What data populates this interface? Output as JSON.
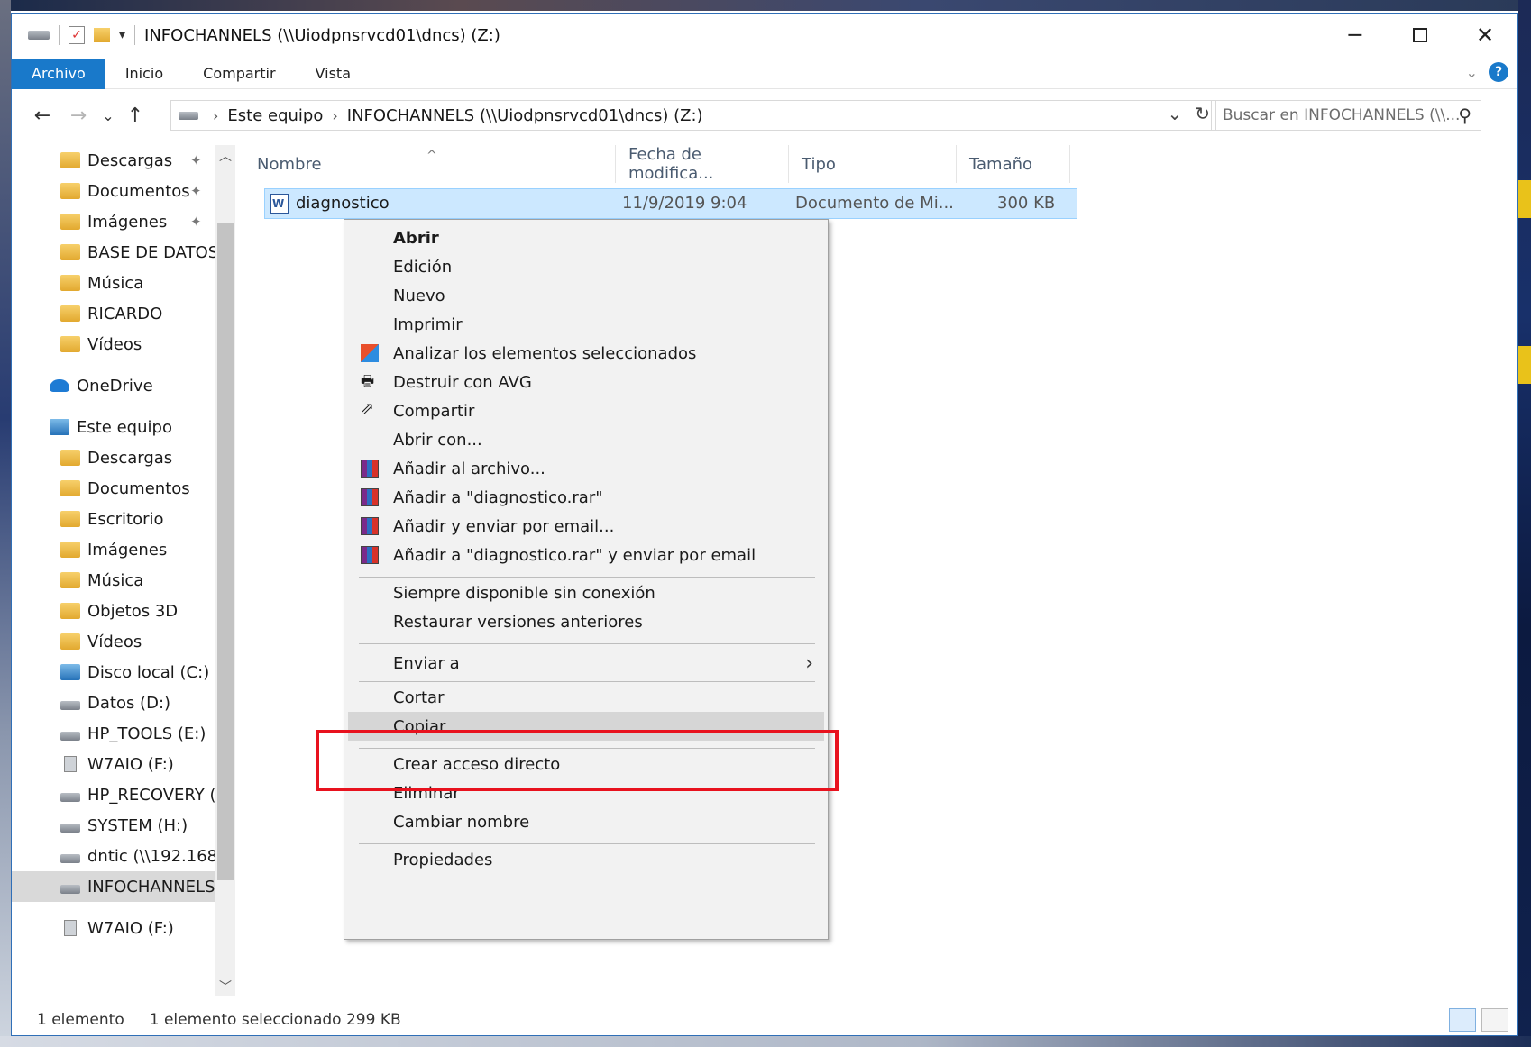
{
  "window": {
    "title": "INFOCHANNELS (\\\\Uiodpnsrvcd01\\dncs) (Z:)",
    "controls": [
      "minimize-icon",
      "maximize-icon",
      "close-icon"
    ]
  },
  "ribbon": {
    "tabs": [
      "Archivo",
      "Inicio",
      "Compartir",
      "Vista"
    ],
    "active_tab": "Archivo",
    "help": "?"
  },
  "address": {
    "back": "←",
    "forward": "→",
    "recent": "⌄",
    "up": "↑",
    "crumbs": [
      "Este equipo",
      "INFOCHANNELS (\\\\Uiodpnsrvcd01\\dncs) (Z:)"
    ],
    "dropdown": "⌄",
    "refresh": "↻"
  },
  "search": {
    "placeholder": "Buscar en INFOCHANNELS (\\\\...",
    "icon": "⚲"
  },
  "nav": {
    "items": [
      {
        "label": "Descargas",
        "icon": "download-folder-icon",
        "pinned": true
      },
      {
        "label": "Documentos",
        "icon": "documents-folder-icon",
        "pinned": true
      },
      {
        "label": "Imágenes",
        "icon": "pictures-folder-icon",
        "pinned": true
      },
      {
        "label": "BASE DE DATOS",
        "icon": "folder-icon",
        "pinned": false
      },
      {
        "label": "Música",
        "icon": "music-folder-icon",
        "pinned": false
      },
      {
        "label": "RICARDO",
        "icon": "folder-icon",
        "pinned": false
      },
      {
        "label": "Vídeos",
        "icon": "videos-folder-icon",
        "pinned": false
      },
      {
        "label": "OneDrive",
        "icon": "onedrive-icon",
        "pinned": false
      },
      {
        "label": "Este equipo",
        "icon": "this-pc-icon",
        "pinned": false
      },
      {
        "label": "Descargas",
        "icon": "download-folder-icon",
        "pinned": false
      },
      {
        "label": "Documentos",
        "icon": "documents-folder-icon",
        "pinned": false
      },
      {
        "label": "Escritorio",
        "icon": "desktop-folder-icon",
        "pinned": false
      },
      {
        "label": "Imágenes",
        "icon": "pictures-folder-icon",
        "pinned": false
      },
      {
        "label": "Música",
        "icon": "music-folder-icon",
        "pinned": false
      },
      {
        "label": "Objetos 3D",
        "icon": "objects-3d-icon",
        "pinned": false
      },
      {
        "label": "Vídeos",
        "icon": "videos-folder-icon",
        "pinned": false
      },
      {
        "label": "Disco local (C:)",
        "icon": "local-disk-icon",
        "pinned": false
      },
      {
        "label": "Datos (D:)",
        "icon": "drive-icon",
        "pinned": false
      },
      {
        "label": "HP_TOOLS (E:)",
        "icon": "drive-icon",
        "pinned": false
      },
      {
        "label": "W7AIO (F:)",
        "icon": "usb-drive-icon",
        "pinned": false
      },
      {
        "label": "HP_RECOVERY (G:)",
        "icon": "drive-icon",
        "pinned": false
      },
      {
        "label": "SYSTEM (H:)",
        "icon": "drive-icon",
        "pinned": false
      },
      {
        "label": "dntic (\\\\192.168.",
        "icon": "network-drive-icon",
        "pinned": false
      },
      {
        "label": "INFOCHANNELS",
        "icon": "network-drive-icon",
        "pinned": false,
        "selected": true
      },
      {
        "label": "W7AIO (F:)",
        "icon": "usb-drive-icon",
        "pinned": false
      }
    ],
    "pin_glyph": "📌"
  },
  "list": {
    "columns": [
      "Nombre",
      "Fecha de modifica...",
      "Tipo",
      "Tamaño"
    ],
    "sort_caret": "^",
    "rows": [
      {
        "name": "diagnostico",
        "date": "11/9/2019 9:04",
        "type": "Documento de Mi...",
        "size": "300 KB"
      }
    ]
  },
  "context_menu": {
    "items": [
      {
        "label": "Abrir",
        "bold": true
      },
      {
        "label": "Edición"
      },
      {
        "label": "Nuevo"
      },
      {
        "label": "Imprimir"
      },
      {
        "label": "Analizar los elementos seleccionados",
        "icon": "avg-scan-icon"
      },
      {
        "label": "Destruir con AVG",
        "icon": "shredder-icon"
      },
      {
        "label": "Compartir",
        "icon": "share-icon"
      },
      {
        "label": "Abrir con..."
      },
      {
        "label": "Añadir al archivo...",
        "icon": "winrar-icon"
      },
      {
        "label": "Añadir a \"diagnostico.rar\"",
        "icon": "winrar-icon"
      },
      {
        "label": "Añadir y enviar por email...",
        "icon": "winrar-icon"
      },
      {
        "label": "Añadir a \"diagnostico.rar\" y enviar por email",
        "icon": "winrar-icon"
      },
      {
        "label": "Siempre disponible sin conexión"
      },
      {
        "label": "Restaurar versiones anteriores"
      },
      {
        "label": "Enviar a",
        "submenu": true
      },
      {
        "label": "Cortar"
      },
      {
        "label": "Copiar",
        "hover": true
      },
      {
        "label": "Crear acceso directo"
      },
      {
        "label": "Eliminar"
      },
      {
        "label": "Cambiar nombre"
      },
      {
        "label": "Propiedades"
      }
    ],
    "submenu_glyph": "›",
    "annotation_color": "#e8121e"
  },
  "status": {
    "count": "1 elemento",
    "selection": "1 elemento seleccionado  299 KB"
  },
  "colors": {
    "accent": "#1979ca",
    "selection": "#cce8ff",
    "menu_hover": "#d6d6d6"
  }
}
